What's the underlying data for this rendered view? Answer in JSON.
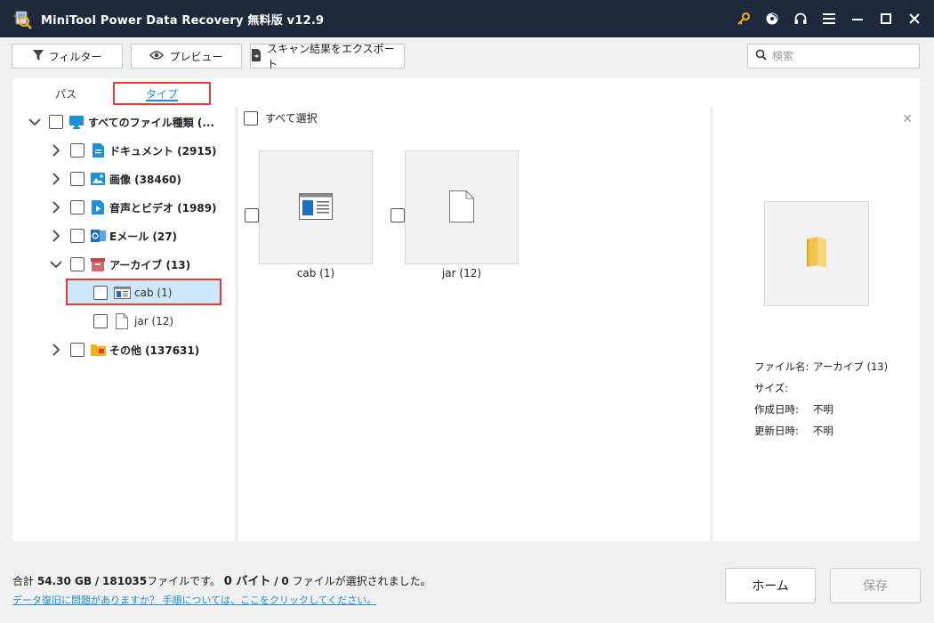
{
  "app": {
    "title": "MiniTool Power Data Recovery 無料版 v12.9"
  },
  "toolbar": {
    "filter_label": "フィルター",
    "preview_label": "プレビュー",
    "export_label": "スキャン結果をエクスポート",
    "search_placeholder": "検索"
  },
  "tabs": {
    "path_label": "パス",
    "type_label": "タイプ"
  },
  "tree": {
    "root": "すべてのファイル種類 (...",
    "items": [
      {
        "label": "ドキュメント (2915)",
        "icon": "document-icon"
      },
      {
        "label": "画像 (38460)",
        "icon": "image-icon"
      },
      {
        "label": "音声とビデオ (1989)",
        "icon": "media-icon"
      },
      {
        "label": "Eメール (27)",
        "icon": "outlook-icon"
      },
      {
        "label": "アーカイブ (13)",
        "icon": "archive-icon"
      },
      {
        "label": "その他 (137631)",
        "icon": "folder-icon"
      }
    ],
    "children": [
      {
        "label": "cab (1)",
        "icon": "cab-file-icon"
      },
      {
        "label": "jar (12)",
        "icon": "blank-file-icon"
      }
    ]
  },
  "content": {
    "select_all_label": "すべて選択",
    "thumbnails": [
      {
        "label": "cab (1)"
      },
      {
        "label": "jar (12)"
      }
    ]
  },
  "preview": {
    "filename_key": "ファイル名:",
    "filename_value": "アーカイブ (13)",
    "size_key": "サイズ:",
    "size_value": "",
    "created_key": "作成日時:",
    "created_value": "不明",
    "modified_key": "更新日時:",
    "modified_value": "不明"
  },
  "footer": {
    "summary_prefix": "合計",
    "total_size": "54.30 GB",
    "slash": "/",
    "total_files": "181035",
    "files_suffix": "ファイルです。",
    "selected_bytes": "0 バイト",
    "slash2": "/",
    "selected_files": "0",
    "selected_suffix": "ファイルが選択されました。",
    "help_link": "データ復旧に問題がありますか？ 手順については、ここをクリックしてください。",
    "home_label": "ホーム",
    "save_label": "保存"
  },
  "colors": {
    "titlebar": "#1e2a3b",
    "accent": "#1e90d6",
    "highlight": "#e53935",
    "selection": "#cde8f8"
  }
}
